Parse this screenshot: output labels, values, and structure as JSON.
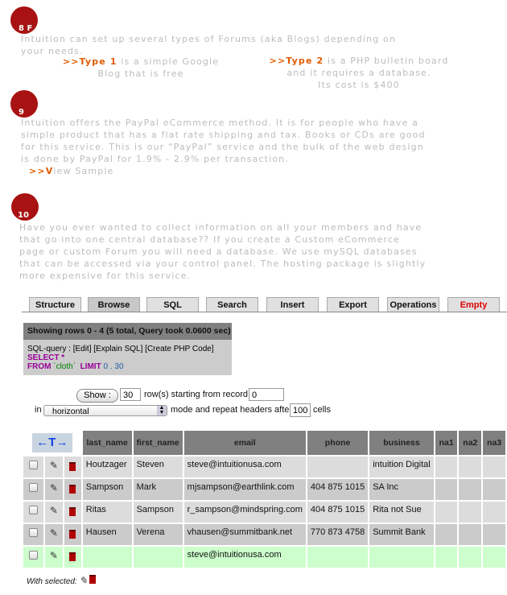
{
  "section8": {
    "number": "8 F",
    "lines": [
      "Intuition can set up several types of Forums (aka Blogs) depending on",
      "your needs."
    ],
    "type1": {
      "link": ">>Type 1",
      "text": " is a simple Google",
      "line2": "Blog that is free"
    },
    "type2": {
      "link": ">>Type 2",
      "text": " is a PHP bulletin board",
      "line2": "and it requires a database.",
      "line3": "Its cost is $400"
    }
  },
  "section9": {
    "number": "9",
    "lines": [
      "Intuition offers the PayPal eCommerce method. It is for people who have a",
      "simple product that has a flat rate shipping and tax.  Books or CDs are good",
      "for this service.  This is our “PayPal” service and the bulk of the web design",
      "is done by PayPal for 1.9% - 2.9% per transaction."
    ],
    "view": {
      "prefix": ">>V",
      "text": "iew Sample"
    }
  },
  "section10": {
    "number": "10",
    "lines": [
      "Have you ever wanted to collect information on all your members and have",
      "that go into one central database??  If you create a Custom eCommerce",
      "page or custom Forum you will need a database.  We use mySQL databases",
      "that can be accessed via your control panel.  The hosting package is slightly",
      "more expensive for this service."
    ]
  },
  "tabs": [
    "Structure",
    "Browse",
    "SQL",
    "Search",
    "Insert",
    "Export",
    "Operations",
    "Empty"
  ],
  "active_tab": "Browse",
  "status": "Showing rows 0 - 4 (5 total, Query took 0.0600 sec)",
  "sql": {
    "label": "SQL-query : [Edit] [Explain SQL] [Create PHP Code]",
    "select": "SELECT *",
    "from": "FROM",
    "table": "`cloth`",
    "limit": "LIMIT",
    "limit_vals": "0 . 30"
  },
  "controls": {
    "show": "Show :",
    "rows": "30",
    "text1": "row(s) starting from record #",
    "start": "0",
    "in": "in",
    "mode": "horizontal",
    "text2": "mode and repeat headers after",
    "repeat": "100",
    "cells": "cells"
  },
  "table": {
    "arrows": "←T→",
    "headers": [
      "last_name",
      "first_name",
      "email",
      "phone",
      "business",
      "na1",
      "na2",
      "na3"
    ],
    "rows": [
      [
        "Houtzager",
        "Steven",
        "steve@intuitionusa.com",
        "",
        "intuition Digital",
        "",
        "",
        ""
      ],
      [
        "Sampson",
        "Mark",
        "mjsampson@earthlink.com",
        "404 875 1015",
        "SA Inc",
        "",
        "",
        ""
      ],
      [
        "Ritas",
        "Sampson",
        "r_sampson@mindspring.com",
        "404 875 1015",
        "Rita not Sue",
        "",
        "",
        ""
      ],
      [
        "Hausen",
        "Verena",
        "vhausen@summitbank.net",
        "770 873 4758",
        "Summit Bank",
        "",
        "",
        ""
      ],
      [
        "",
        "",
        "steve@intuitionusa.com",
        "",
        "",
        "",
        "",
        ""
      ]
    ]
  },
  "with_selected": "With selected:",
  "colors": {
    "accent": "#e05a00",
    "circle": "#a81212",
    "text_gray": "#bcbcbc",
    "new_row": "#ccffcc"
  }
}
